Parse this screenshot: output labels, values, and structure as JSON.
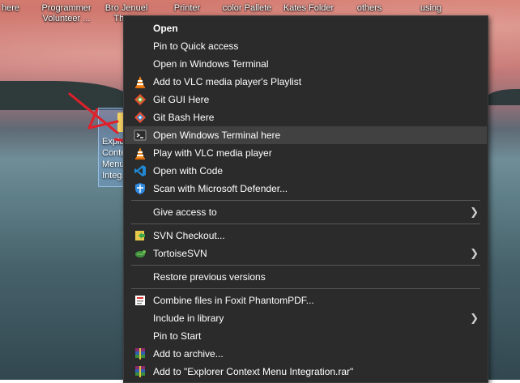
{
  "desktop": {
    "icons": [
      {
        "label": "here"
      },
      {
        "label": "Programmer Volunteer ..."
      },
      {
        "label": "Bro Jenuel Thur..."
      },
      {
        "label": "Printer"
      },
      {
        "label": "color Pallete"
      },
      {
        "label": "Kates Folder"
      },
      {
        "label": "others"
      },
      {
        "label": "using"
      }
    ],
    "selected_file_label": "Explorer Context Menu Integ..."
  },
  "context_menu": {
    "items": [
      {
        "label": "Open",
        "icon": "none"
      },
      {
        "label": "Pin to Quick access",
        "icon": "none"
      },
      {
        "label": "Open in Windows Terminal",
        "icon": "none"
      },
      {
        "label": "Add to VLC media player's Playlist",
        "icon": "vlc-cone-icon"
      },
      {
        "label": "Git GUI Here",
        "icon": "git-gui-icon"
      },
      {
        "label": "Git Bash Here",
        "icon": "git-bash-icon"
      },
      {
        "label": "Open Windows Terminal here",
        "icon": "terminal-icon"
      },
      {
        "label": "Play with VLC media player",
        "icon": "vlc-cone-icon"
      },
      {
        "label": "Open with Code",
        "icon": "vscode-icon"
      },
      {
        "label": "Scan with Microsoft Defender...",
        "icon": "defender-shield-icon"
      },
      {
        "label": "Give access to",
        "icon": "none",
        "submenu": "❯"
      },
      {
        "label": "SVN Checkout...",
        "icon": "svn-checkout-icon"
      },
      {
        "label": "TortoiseSVN",
        "icon": "tortoise-svn-icon",
        "submenu": "❯"
      },
      {
        "label": "Restore previous versions",
        "icon": "none"
      },
      {
        "label": "Combine files in Foxit PhantomPDF...",
        "icon": "foxit-icon"
      },
      {
        "label": "Include in library",
        "icon": "none",
        "submenu": "❯"
      },
      {
        "label": "Pin to Start",
        "icon": "none"
      },
      {
        "label": "Add to archive...",
        "icon": "winrar-icon"
      },
      {
        "label": "Add to \"Explorer Context Menu Integration.rar\"",
        "icon": "winrar-icon"
      }
    ]
  },
  "colors": {
    "menu_bg": "#2b2b2b",
    "menu_highlight": "#414141",
    "annotation_red": "#e0202a"
  }
}
